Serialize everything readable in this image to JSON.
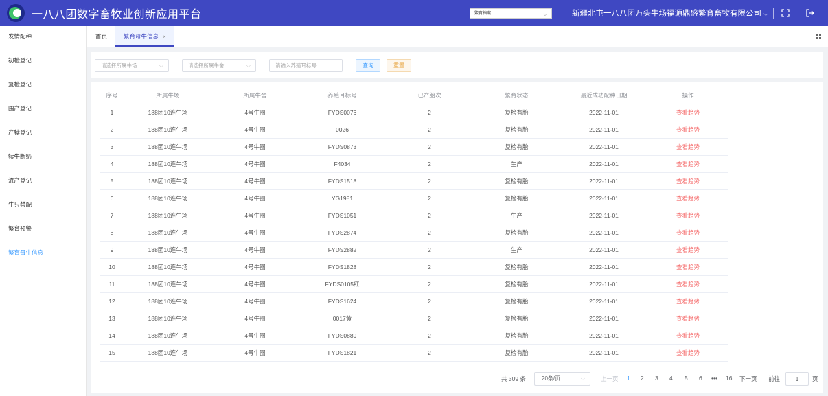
{
  "header": {
    "title": "一八八团数字畜牧业创新应用平台",
    "module_select": "繁育档案",
    "company": "新疆北屯一八八团万头牛场福源鼎盛繁育畜牧有限公司"
  },
  "sidebar": {
    "items": [
      {
        "label": "发情配种"
      },
      {
        "label": "初检登记"
      },
      {
        "label": "复检登记"
      },
      {
        "label": "围产登记"
      },
      {
        "label": "产犊登记"
      },
      {
        "label": "犊牛断奶"
      },
      {
        "label": "流产登记"
      },
      {
        "label": "牛只禁配"
      },
      {
        "label": "繁育预警"
      },
      {
        "label": "繁育母牛信息",
        "active": true
      }
    ]
  },
  "tabs": [
    {
      "label": "首页",
      "active": false
    },
    {
      "label": "繁育母牛信息",
      "active": true,
      "close": "×"
    }
  ],
  "filters": {
    "farm_placeholder": "请选择所属牛场",
    "barn_placeholder": "请选择所属牛舍",
    "eartag_placeholder": "请输入养殖耳标号",
    "query_label": "查询",
    "reset_label": "重置"
  },
  "table": {
    "columns": [
      "序号",
      "所属牛场",
      "所属牛舍",
      "养殖耳标号",
      "已产胎次",
      "繁育状态",
      "最近成功配种日期",
      "操作"
    ],
    "rows": [
      [
        "1",
        "188团10连牛场",
        "4号牛圈",
        "FYDS0076",
        "2",
        "复检有胎",
        "2022-11-01",
        "查看趋势"
      ],
      [
        "2",
        "188团10连牛场",
        "4号牛圈",
        "0026",
        "2",
        "复检有胎",
        "2022-11-01",
        "查看趋势"
      ],
      [
        "3",
        "188团10连牛场",
        "4号牛圈",
        "FYDS0873",
        "2",
        "复检有胎",
        "2022-11-01",
        "查看趋势"
      ],
      [
        "4",
        "188团10连牛场",
        "4号牛圈",
        "F4034",
        "2",
        "生产",
        "2022-11-01",
        "查看趋势"
      ],
      [
        "5",
        "188团10连牛场",
        "4号牛圈",
        "FYDS1518",
        "2",
        "复检有胎",
        "2022-11-01",
        "查看趋势"
      ],
      [
        "6",
        "188团10连牛场",
        "4号牛圈",
        "YG1981",
        "2",
        "复检有胎",
        "2022-11-01",
        "查看趋势"
      ],
      [
        "7",
        "188团10连牛场",
        "4号牛圈",
        "FYDS1051",
        "2",
        "生产",
        "2022-11-01",
        "查看趋势"
      ],
      [
        "8",
        "188团10连牛场",
        "4号牛圈",
        "FYDS2874",
        "2",
        "复检有胎",
        "2022-11-01",
        "查看趋势"
      ],
      [
        "9",
        "188团10连牛场",
        "4号牛圈",
        "FYDS2882",
        "2",
        "生产",
        "2022-11-01",
        "查看趋势"
      ],
      [
        "10",
        "188团10连牛场",
        "4号牛圈",
        "FYDS1828",
        "2",
        "复检有胎",
        "2022-11-01",
        "查看趋势"
      ],
      [
        "11",
        "188团10连牛场",
        "4号牛圈",
        "FYDS0105红",
        "2",
        "复检有胎",
        "2022-11-01",
        "查看趋势"
      ],
      [
        "12",
        "188团10连牛场",
        "4号牛圈",
        "FYDS1624",
        "2",
        "复检有胎",
        "2022-11-01",
        "查看趋势"
      ],
      [
        "13",
        "188团10连牛场",
        "4号牛圈",
        "0017黄",
        "2",
        "复检有胎",
        "2022-11-01",
        "查看趋势"
      ],
      [
        "14",
        "188团10连牛场",
        "4号牛圈",
        "FYDS0889",
        "2",
        "复检有胎",
        "2022-11-01",
        "查看趋势"
      ],
      [
        "15",
        "188团10连牛场",
        "4号牛圈",
        "FYDS1821",
        "2",
        "复检有胎",
        "2022-11-01",
        "查看趋势"
      ]
    ]
  },
  "pagination": {
    "total": "共 309 条",
    "page_size": "20条/页",
    "prev": "上一页",
    "pages": [
      "1",
      "2",
      "3",
      "4",
      "5",
      "6",
      "•••",
      "16"
    ],
    "current": "1",
    "next": "下一页",
    "goto_label": "前往",
    "goto_value": "1",
    "page_suffix": "页"
  },
  "colors": {
    "header_bg": "#3f48c2",
    "accent": "#409eff",
    "link_red": "#f56c6c"
  },
  "icons": [
    "fullscreen-icon",
    "logout-icon",
    "grid-menu-icon",
    "chevron-down-icon"
  ]
}
